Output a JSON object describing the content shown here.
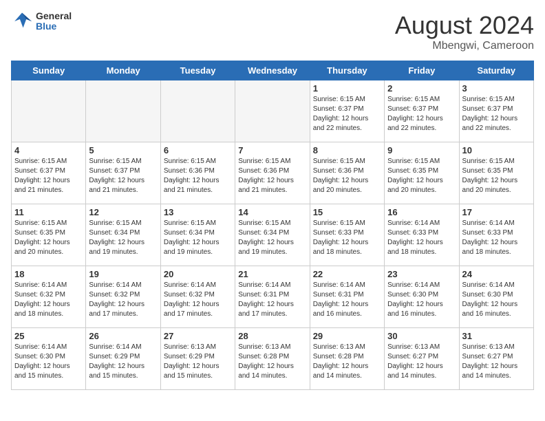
{
  "header": {
    "logo_line1": "General",
    "logo_line2": "Blue",
    "month_title": "August 2024",
    "location": "Mbengwi, Cameroon"
  },
  "weekdays": [
    "Sunday",
    "Monday",
    "Tuesday",
    "Wednesday",
    "Thursday",
    "Friday",
    "Saturday"
  ],
  "weeks": [
    [
      {
        "day": "",
        "info": ""
      },
      {
        "day": "",
        "info": ""
      },
      {
        "day": "",
        "info": ""
      },
      {
        "day": "",
        "info": ""
      },
      {
        "day": "1",
        "info": "Sunrise: 6:15 AM\nSunset: 6:37 PM\nDaylight: 12 hours\nand 22 minutes."
      },
      {
        "day": "2",
        "info": "Sunrise: 6:15 AM\nSunset: 6:37 PM\nDaylight: 12 hours\nand 22 minutes."
      },
      {
        "day": "3",
        "info": "Sunrise: 6:15 AM\nSunset: 6:37 PM\nDaylight: 12 hours\nand 22 minutes."
      }
    ],
    [
      {
        "day": "4",
        "info": "Sunrise: 6:15 AM\nSunset: 6:37 PM\nDaylight: 12 hours\nand 21 minutes."
      },
      {
        "day": "5",
        "info": "Sunrise: 6:15 AM\nSunset: 6:37 PM\nDaylight: 12 hours\nand 21 minutes."
      },
      {
        "day": "6",
        "info": "Sunrise: 6:15 AM\nSunset: 6:36 PM\nDaylight: 12 hours\nand 21 minutes."
      },
      {
        "day": "7",
        "info": "Sunrise: 6:15 AM\nSunset: 6:36 PM\nDaylight: 12 hours\nand 21 minutes."
      },
      {
        "day": "8",
        "info": "Sunrise: 6:15 AM\nSunset: 6:36 PM\nDaylight: 12 hours\nand 20 minutes."
      },
      {
        "day": "9",
        "info": "Sunrise: 6:15 AM\nSunset: 6:35 PM\nDaylight: 12 hours\nand 20 minutes."
      },
      {
        "day": "10",
        "info": "Sunrise: 6:15 AM\nSunset: 6:35 PM\nDaylight: 12 hours\nand 20 minutes."
      }
    ],
    [
      {
        "day": "11",
        "info": "Sunrise: 6:15 AM\nSunset: 6:35 PM\nDaylight: 12 hours\nand 20 minutes."
      },
      {
        "day": "12",
        "info": "Sunrise: 6:15 AM\nSunset: 6:34 PM\nDaylight: 12 hours\nand 19 minutes."
      },
      {
        "day": "13",
        "info": "Sunrise: 6:15 AM\nSunset: 6:34 PM\nDaylight: 12 hours\nand 19 minutes."
      },
      {
        "day": "14",
        "info": "Sunrise: 6:15 AM\nSunset: 6:34 PM\nDaylight: 12 hours\nand 19 minutes."
      },
      {
        "day": "15",
        "info": "Sunrise: 6:15 AM\nSunset: 6:33 PM\nDaylight: 12 hours\nand 18 minutes."
      },
      {
        "day": "16",
        "info": "Sunrise: 6:14 AM\nSunset: 6:33 PM\nDaylight: 12 hours\nand 18 minutes."
      },
      {
        "day": "17",
        "info": "Sunrise: 6:14 AM\nSunset: 6:33 PM\nDaylight: 12 hours\nand 18 minutes."
      }
    ],
    [
      {
        "day": "18",
        "info": "Sunrise: 6:14 AM\nSunset: 6:32 PM\nDaylight: 12 hours\nand 18 minutes."
      },
      {
        "day": "19",
        "info": "Sunrise: 6:14 AM\nSunset: 6:32 PM\nDaylight: 12 hours\nand 17 minutes."
      },
      {
        "day": "20",
        "info": "Sunrise: 6:14 AM\nSunset: 6:32 PM\nDaylight: 12 hours\nand 17 minutes."
      },
      {
        "day": "21",
        "info": "Sunrise: 6:14 AM\nSunset: 6:31 PM\nDaylight: 12 hours\nand 17 minutes."
      },
      {
        "day": "22",
        "info": "Sunrise: 6:14 AM\nSunset: 6:31 PM\nDaylight: 12 hours\nand 16 minutes."
      },
      {
        "day": "23",
        "info": "Sunrise: 6:14 AM\nSunset: 6:30 PM\nDaylight: 12 hours\nand 16 minutes."
      },
      {
        "day": "24",
        "info": "Sunrise: 6:14 AM\nSunset: 6:30 PM\nDaylight: 12 hours\nand 16 minutes."
      }
    ],
    [
      {
        "day": "25",
        "info": "Sunrise: 6:14 AM\nSunset: 6:30 PM\nDaylight: 12 hours\nand 15 minutes."
      },
      {
        "day": "26",
        "info": "Sunrise: 6:14 AM\nSunset: 6:29 PM\nDaylight: 12 hours\nand 15 minutes."
      },
      {
        "day": "27",
        "info": "Sunrise: 6:13 AM\nSunset: 6:29 PM\nDaylight: 12 hours\nand 15 minutes."
      },
      {
        "day": "28",
        "info": "Sunrise: 6:13 AM\nSunset: 6:28 PM\nDaylight: 12 hours\nand 14 minutes."
      },
      {
        "day": "29",
        "info": "Sunrise: 6:13 AM\nSunset: 6:28 PM\nDaylight: 12 hours\nand 14 minutes."
      },
      {
        "day": "30",
        "info": "Sunrise: 6:13 AM\nSunset: 6:27 PM\nDaylight: 12 hours\nand 14 minutes."
      },
      {
        "day": "31",
        "info": "Sunrise: 6:13 AM\nSunset: 6:27 PM\nDaylight: 12 hours\nand 14 minutes."
      }
    ]
  ]
}
